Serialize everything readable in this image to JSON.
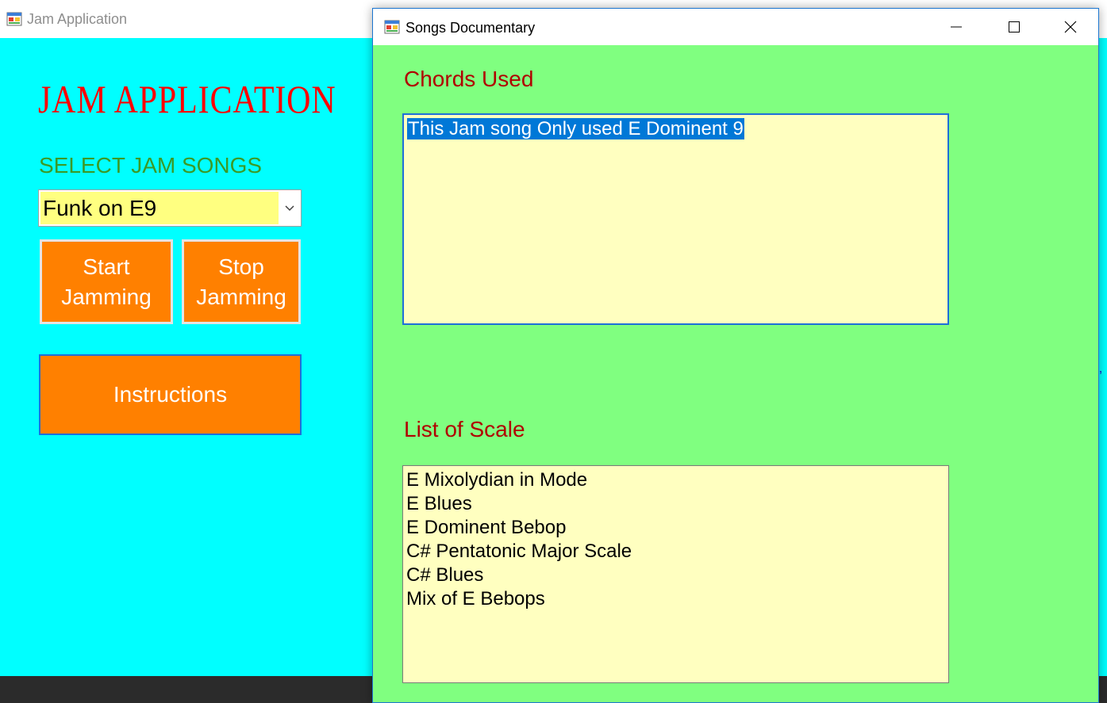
{
  "main_window": {
    "title": "Jam Application",
    "heading": "JAM APPLICATION",
    "select_label": "SELECT JAM SONGS",
    "song_select": {
      "selected": "Funk on E9"
    },
    "buttons": {
      "start": "Start\nJamming",
      "stop": "Stop\nJamming",
      "instructions": "Instructions"
    }
  },
  "dialog": {
    "title": "Songs Documentary",
    "chords_label": "Chords Used",
    "chords_text": "This Jam song Only used E Dominent 9",
    "scales_label": "List of Scale",
    "scales": [
      "E Mixolydian in Mode",
      "E Blues",
      "E Dominent Bebop",
      "C# Pentatonic Major Scale",
      "C# Blues",
      "Mix of E Bebops"
    ]
  },
  "colors": {
    "main_background": "#00ffff",
    "dialog_background": "#80ff80",
    "heading": "#ff0000",
    "select_label": "#3b9a26",
    "button": "#ff8000",
    "textbox_background": "#ffffc0",
    "section_label": "#b00000",
    "selection": "#0078d7"
  },
  "icons": [
    "app-icon",
    "chevron-down-icon",
    "minimize-icon",
    "maximize-icon",
    "close-icon"
  ]
}
